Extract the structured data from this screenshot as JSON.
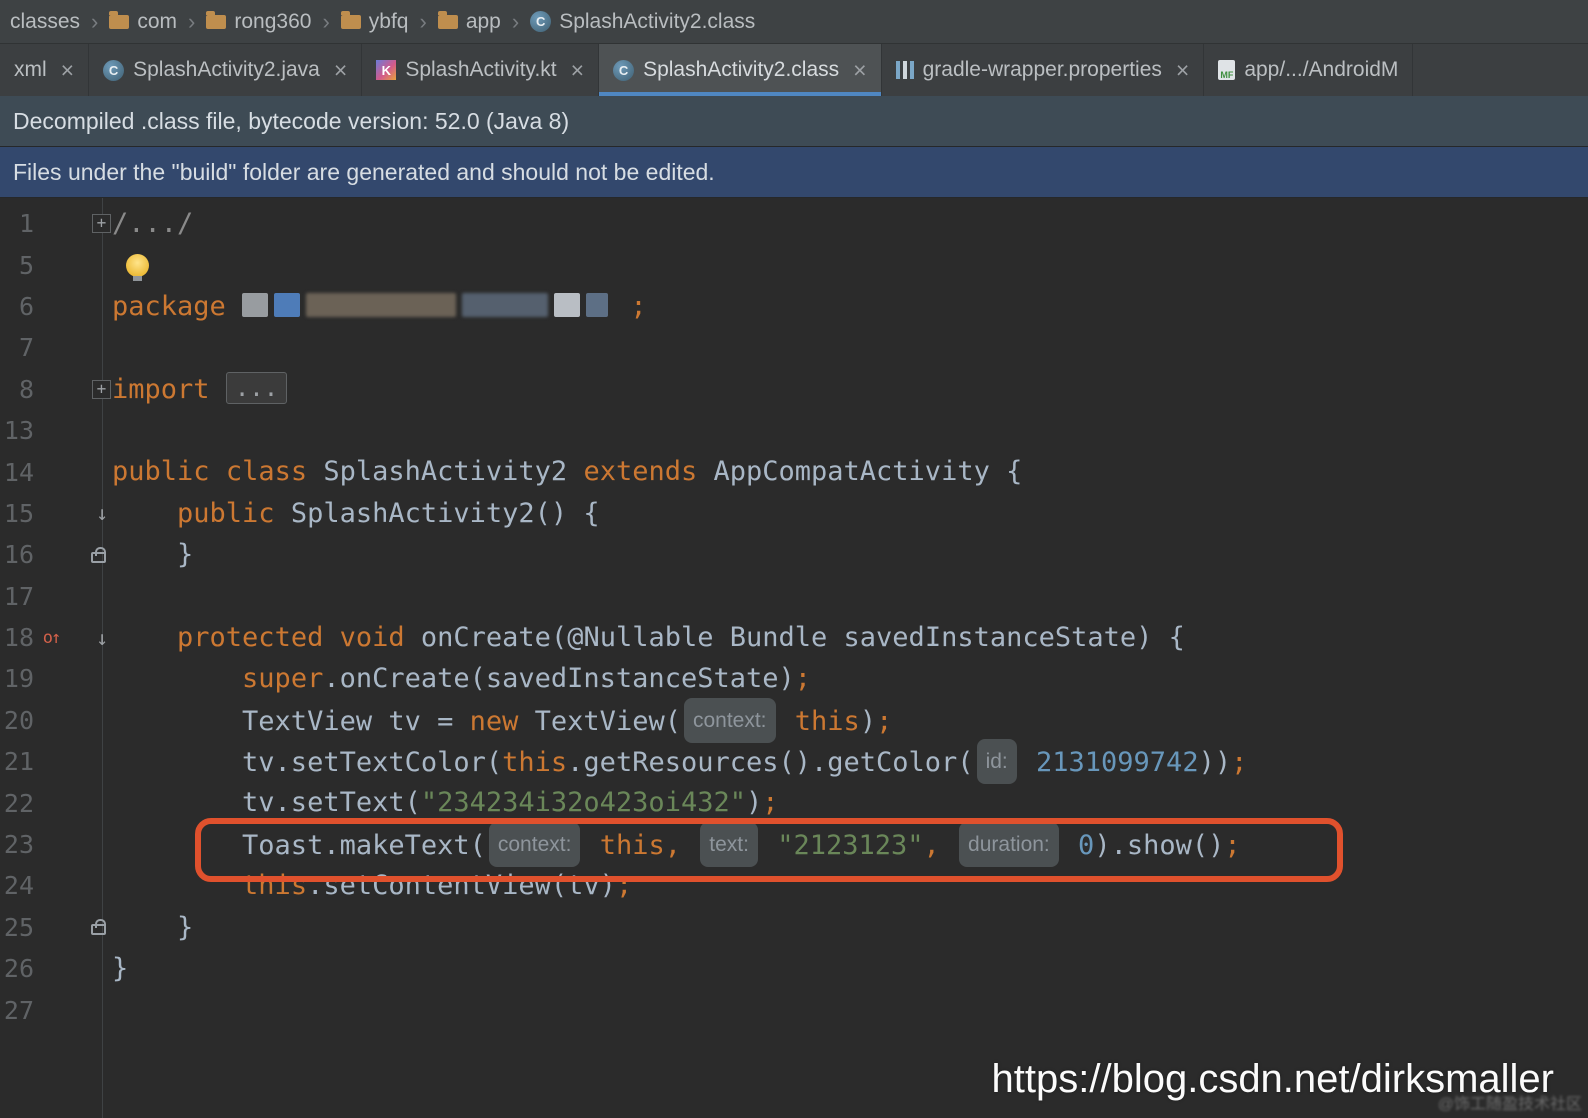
{
  "breadcrumb": {
    "items": [
      {
        "label": "classes",
        "icon": "none"
      },
      {
        "label": "com",
        "icon": "folder"
      },
      {
        "label": "rong360",
        "icon": "folder"
      },
      {
        "label": "ybfq",
        "icon": "folder"
      },
      {
        "label": "app",
        "icon": "folder"
      },
      {
        "label": "SplashActivity2.class",
        "icon": "class"
      }
    ]
  },
  "tabs": [
    {
      "label": "xml",
      "icon": "none",
      "active": false,
      "closable": true
    },
    {
      "label": "SplashActivity2.java",
      "icon": "class",
      "active": false,
      "closable": true
    },
    {
      "label": "SplashActivity.kt",
      "icon": "kotlin",
      "active": false,
      "closable": true
    },
    {
      "label": "SplashActivity2.class",
      "icon": "class",
      "active": true,
      "closable": true
    },
    {
      "label": "gradle-wrapper.properties",
      "icon": "gradle",
      "active": false,
      "closable": true
    },
    {
      "label": "app/.../AndroidM",
      "icon": "manifest",
      "active": false,
      "closable": false
    }
  ],
  "banners": [
    {
      "id": "decompiled",
      "text": "Decompiled .class file, bytecode version: 52.0 (Java 8)"
    },
    {
      "id": "build-warning",
      "text": "Files under the \"build\" folder are generated and should not be edited."
    }
  ],
  "editor": {
    "lines": [
      {
        "num": "1",
        "gutter": "fold",
        "tokens": [
          [
            "cm",
            "/.../"
          ]
        ]
      },
      {
        "num": "5",
        "tokens": [
          [
            "bulb",
            ""
          ]
        ]
      },
      {
        "num": "6",
        "tokens": [
          [
            "kw",
            "package"
          ],
          [
            "pl",
            " "
          ],
          [
            "block",
            "",
            "#989ca0",
            26
          ],
          [
            "block",
            "",
            "#4e7cb8",
            26
          ],
          [
            "blockn",
            "",
            "#6b6256",
            150
          ],
          [
            "blockn",
            "",
            "#55606e",
            86
          ],
          [
            "block",
            "",
            "#b9bec4",
            26
          ],
          [
            "block",
            "",
            "#5d6f85",
            22
          ],
          [
            "kw",
            " ;"
          ]
        ]
      },
      {
        "num": "7",
        "tokens": []
      },
      {
        "num": "8",
        "gutter": "fold",
        "tokens": [
          [
            "kw",
            "import"
          ],
          [
            "pl",
            " "
          ],
          [
            "fold",
            "..."
          ]
        ]
      },
      {
        "num": "13",
        "tokens": []
      },
      {
        "num": "14",
        "tokens": [
          [
            "kw",
            "public"
          ],
          [
            "pl",
            " "
          ],
          [
            "kw",
            "class"
          ],
          [
            "pl",
            " SplashActivity2 "
          ],
          [
            "kw",
            "extends"
          ],
          [
            "pl",
            " AppCompatActivity {"
          ]
        ]
      },
      {
        "num": "15",
        "gutter": "arrow",
        "tokens": [
          [
            "pl",
            "    "
          ],
          [
            "kw",
            "public"
          ],
          [
            "pl",
            " SplashActivity2() {"
          ]
        ]
      },
      {
        "num": "16",
        "gutter": "lock",
        "tokens": [
          [
            "pl",
            "    }"
          ]
        ]
      },
      {
        "num": "17",
        "tokens": []
      },
      {
        "num": "18",
        "left": "override",
        "gutter": "arrow",
        "tokens": [
          [
            "pl",
            "    "
          ],
          [
            "kw",
            "protected"
          ],
          [
            "pl",
            " "
          ],
          [
            "kw",
            "void"
          ],
          [
            "pl",
            " onCreate(@Nullable Bundle savedInstanceState) {"
          ]
        ]
      },
      {
        "num": "19",
        "tokens": [
          [
            "pl",
            "        "
          ],
          [
            "kw",
            "super"
          ],
          [
            "pl",
            ".onCreate(savedInstanceState)"
          ],
          [
            "kw",
            ";"
          ]
        ]
      },
      {
        "num": "20",
        "tokens": [
          [
            "pl",
            "        TextView tv = "
          ],
          [
            "kw",
            "new"
          ],
          [
            "pl",
            " TextView("
          ],
          [
            "hint",
            "context:"
          ],
          [
            "pl",
            " "
          ],
          [
            "kw",
            "this"
          ],
          [
            "pl",
            ")"
          ],
          [
            "kw",
            ";"
          ]
        ]
      },
      {
        "num": "21",
        "tokens": [
          [
            "pl",
            "        tv.setTextColor("
          ],
          [
            "kw",
            "this"
          ],
          [
            "pl",
            ".getResources().getColor("
          ],
          [
            "hint",
            "id:"
          ],
          [
            "pl",
            " "
          ],
          [
            "nu",
            "2131099742"
          ],
          [
            "pl",
            "))"
          ],
          [
            "kw",
            ";"
          ]
        ]
      },
      {
        "num": "22",
        "tokens": [
          [
            "pl",
            "        tv.setText("
          ],
          [
            "st",
            "\"234234i32o423oi432\""
          ],
          [
            "pl",
            ")"
          ],
          [
            "kw",
            ";"
          ]
        ]
      },
      {
        "num": "23",
        "tokens": [
          [
            "pl",
            "        Toast.makeText("
          ],
          [
            "hint",
            "context:"
          ],
          [
            "pl",
            " "
          ],
          [
            "kw",
            "this"
          ],
          [
            "kw",
            ","
          ],
          [
            "pl",
            " "
          ],
          [
            "hint",
            "text:"
          ],
          [
            "pl",
            " "
          ],
          [
            "st",
            "\"2123123\""
          ],
          [
            "kw",
            ","
          ],
          [
            "pl",
            " "
          ],
          [
            "hint",
            "duration:"
          ],
          [
            "pl",
            " "
          ],
          [
            "nu",
            "0"
          ],
          [
            "pl",
            ").show()"
          ],
          [
            "kw",
            ";"
          ]
        ]
      },
      {
        "num": "24",
        "tokens": [
          [
            "pl",
            "        "
          ],
          [
            "kw",
            "this"
          ],
          [
            "pl",
            ".setContentView(tv)"
          ],
          [
            "kw",
            ";"
          ]
        ]
      },
      {
        "num": "25",
        "gutter": "lock",
        "tokens": [
          [
            "pl",
            "    }"
          ]
        ]
      },
      {
        "num": "26",
        "tokens": [
          [
            "pl",
            "}"
          ]
        ]
      },
      {
        "num": "27",
        "tokens": []
      }
    ]
  },
  "annotation": {
    "color": "#e0512d"
  },
  "watermark": {
    "url": "https://blog.csdn.net/dirksmaller",
    "corner": "@饰工随盈技术社区"
  },
  "colors": {
    "keyword": "#cc7832",
    "string": "#6a8759",
    "number": "#6897bb",
    "background": "#2b2b2b",
    "accent_underline": "#4f87c2"
  }
}
